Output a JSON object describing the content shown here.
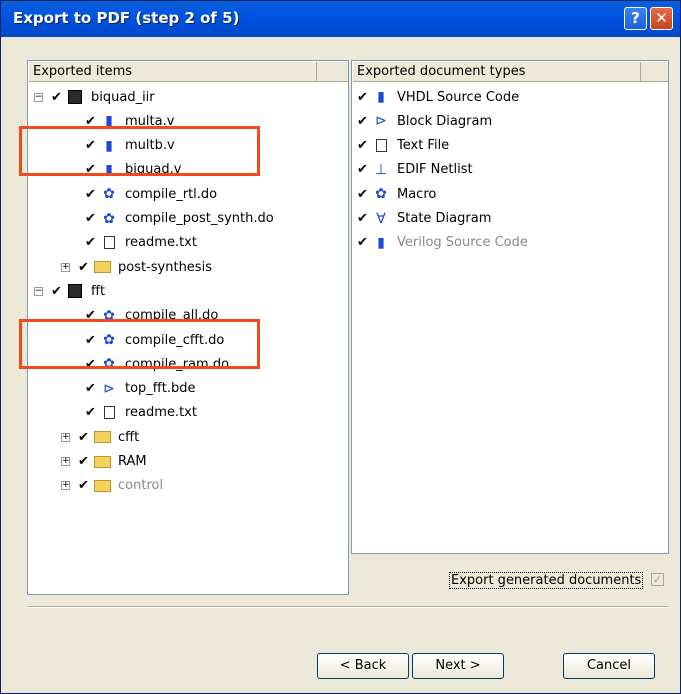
{
  "window": {
    "title": "Export to PDF (step 2 of 5)",
    "help_label": "?",
    "close_label": "✕"
  },
  "left_panel": {
    "header": "Exported items",
    "items": [
      {
        "label": "biquad_iir",
        "expander": "−",
        "check": "✔",
        "icon": "project-icon",
        "gray": false
      },
      {
        "label": "multa.v",
        "expander": "",
        "check": "✔",
        "icon": "verilog-file-icon",
        "gray": false
      },
      {
        "label": "multb.v",
        "expander": "",
        "check": "✔",
        "icon": "verilog-file-icon",
        "gray": false
      },
      {
        "label": "biquad.v",
        "expander": "",
        "check": "✔",
        "icon": "verilog-file-icon",
        "gray": false
      },
      {
        "label": "compile_rtl.do",
        "expander": "",
        "check": "✔",
        "icon": "macro-icon",
        "gray": false
      },
      {
        "label": "compile_post_synth.do",
        "expander": "",
        "check": "✔",
        "icon": "macro-icon",
        "gray": false
      },
      {
        "label": "readme.txt",
        "expander": "",
        "check": "✔",
        "icon": "text-file-icon",
        "gray": false
      },
      {
        "label": "post-synthesis",
        "expander": "+",
        "check": "✔",
        "icon": "folder-icon",
        "gray": false
      },
      {
        "label": "fft",
        "expander": "−",
        "check": "✔",
        "icon": "project-icon",
        "gray": false
      },
      {
        "label": "compile_all.do",
        "expander": "",
        "check": "✔",
        "icon": "macro-icon",
        "gray": false
      },
      {
        "label": "compile_cfft.do",
        "expander": "",
        "check": "✔",
        "icon": "macro-icon",
        "gray": false
      },
      {
        "label": "compile_ram.do",
        "expander": "",
        "check": "✔",
        "icon": "macro-icon",
        "gray": false
      },
      {
        "label": "top_fft.bde",
        "expander": "",
        "check": "✔",
        "icon": "block-diagram-icon",
        "gray": false
      },
      {
        "label": "readme.txt",
        "expander": "",
        "check": "✔",
        "icon": "text-file-icon",
        "gray": false
      },
      {
        "label": "cfft",
        "expander": "+",
        "check": "✔",
        "icon": "folder-icon",
        "gray": false
      },
      {
        "label": "RAM",
        "expander": "+",
        "check": "✔",
        "icon": "folder-icon",
        "gray": false
      },
      {
        "label": "control",
        "expander": "+",
        "check": "✔",
        "icon": "folder-icon",
        "gray": true
      }
    ]
  },
  "right_panel": {
    "header": "Exported document types",
    "items": [
      {
        "label": "VHDL Source Code",
        "check": "✔",
        "icon": "vhdl-file-icon",
        "gray": false
      },
      {
        "label": "Block Diagram",
        "check": "✔",
        "icon": "block-diagram-icon",
        "gray": false
      },
      {
        "label": "Text File",
        "check": "✔",
        "icon": "text-file-icon",
        "gray": false
      },
      {
        "label": "EDIF Netlist",
        "check": "✔",
        "icon": "edif-netlist-icon",
        "gray": false
      },
      {
        "label": "Macro",
        "check": "✔",
        "icon": "macro-icon",
        "gray": false
      },
      {
        "label": "State Diagram",
        "check": "✔",
        "icon": "state-diagram-icon",
        "gray": false
      },
      {
        "label": "Verilog Source Code",
        "check": "✔",
        "icon": "verilog-file-icon",
        "gray": true
      }
    ]
  },
  "export_generated": {
    "label": "Export generated documents",
    "check": "✓"
  },
  "buttons": {
    "back": "< Back",
    "next": "Next >",
    "cancel": "Cancel"
  },
  "colors": {
    "highlight": "#f04a1e",
    "title_bar": "#0054e3"
  }
}
